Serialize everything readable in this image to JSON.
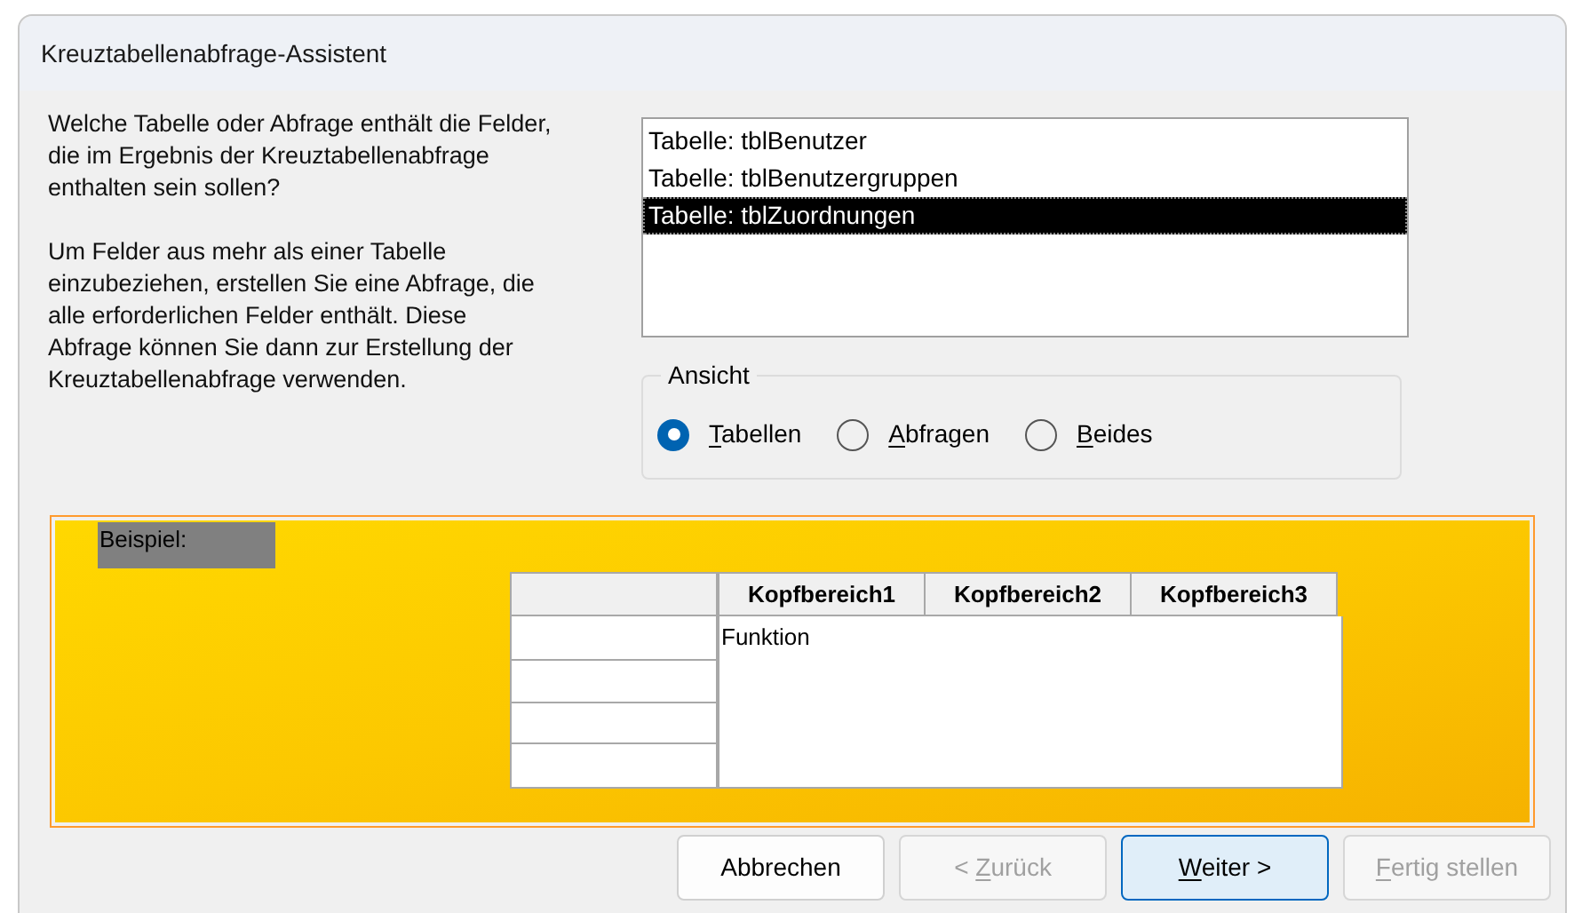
{
  "window": {
    "title": "Kreuztabellenabfrage-Assistent"
  },
  "instructions": [
    "Welche Tabelle oder Abfrage enthält die Felder, die im Ergebnis der Kreuztabellenabfrage enthalten sein sollen?",
    "Um Felder aus mehr als einer Tabelle einzubeziehen, erstellen Sie eine Abfrage, die alle erforderlichen Felder enthält. Diese Abfrage können Sie dann zur Erstellung der Kreuztabellenabfrage verwenden."
  ],
  "source_list": [
    {
      "label": "Tabelle: tblBenutzer",
      "selected": false
    },
    {
      "label": "Tabelle: tblBenutzergruppen",
      "selected": false
    },
    {
      "label": "Tabelle: tblZuordnungen",
      "selected": true
    }
  ],
  "view_group": {
    "title": "Ansicht",
    "options": [
      {
        "access_key": "T",
        "label_rest": "abellen",
        "selected": true
      },
      {
        "access_key": "A",
        "label_rest": "bfragen",
        "selected": false
      },
      {
        "access_key": "B",
        "label_rest": "eides",
        "selected": false
      }
    ]
  },
  "example": {
    "label": "Beispiel:",
    "headers": [
      "Kopfbereich1",
      "Kopfbereich2",
      "Kopfbereich3"
    ],
    "body_text": "Funktion"
  },
  "buttons": [
    {
      "label": "Abbrechen",
      "disabled": false,
      "focused": false
    },
    {
      "label_prefix": "< ",
      "access_key": "Z",
      "label_rest": "urück",
      "disabled": true,
      "focused": false
    },
    {
      "access_key": "W",
      "label_rest": "eiter >",
      "disabled": false,
      "focused": true
    },
    {
      "access_key": "F",
      "label_rest": "ertig stellen",
      "disabled": true,
      "focused": false
    }
  ]
}
